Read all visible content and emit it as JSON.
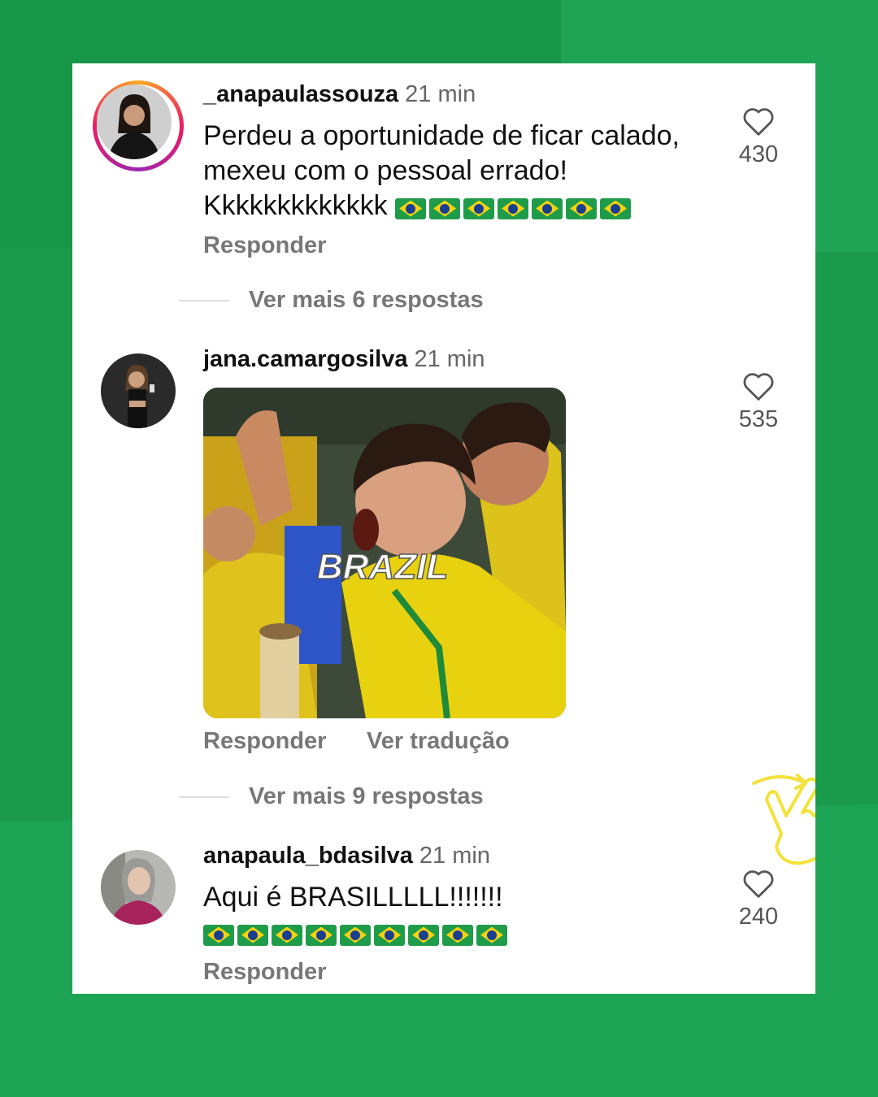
{
  "comments": [
    {
      "username": "_anapaulassouza",
      "time": "21 min",
      "text": "Perdeu a oportunidade de ficar calado, mexeu com o pessoal errado! Kkkkkkkkkkkkk",
      "flags": 7,
      "likes": "430",
      "reply": "Responder",
      "more": "Ver mais 6 respostas"
    },
    {
      "username": "jana.camargosilva",
      "time": "21 min",
      "gif_text": "BRAZIL",
      "likes": "535",
      "reply": "Responder",
      "translate": "Ver tradução",
      "more": "Ver mais 9 respostas"
    },
    {
      "username": "anapaula_bdasilva",
      "time": "21 min",
      "text": "Aqui é BRASILLLLL!!!!!!!",
      "flags": 9,
      "likes": "240",
      "reply": "Responder"
    }
  ],
  "colors": {
    "background": "#1a9a4b",
    "card": "#ffffff",
    "accent_yellow": "#f4e13a"
  },
  "icons": [
    "heart-icon",
    "pointing-hand-icon",
    "brazil-flag-emoji"
  ]
}
